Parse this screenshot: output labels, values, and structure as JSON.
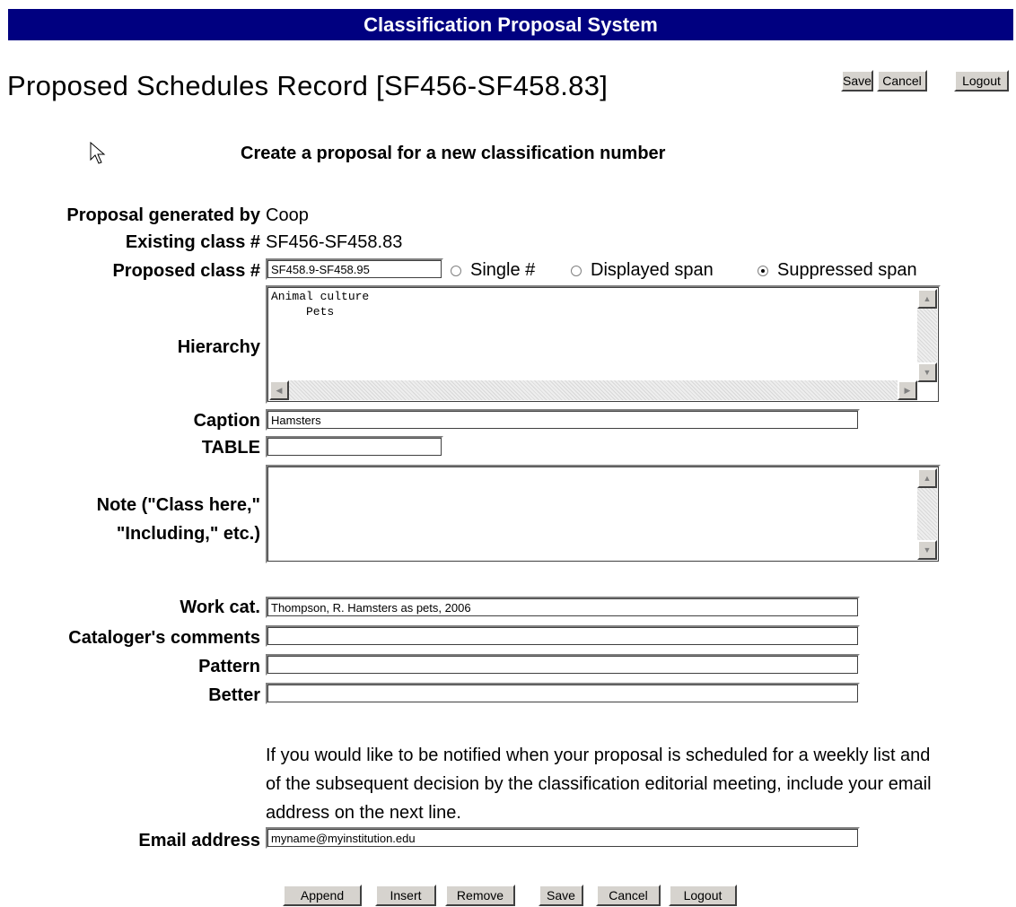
{
  "app_title": "Classification Proposal System",
  "page_title": "Proposed Schedules Record [SF456-SF458.83]",
  "top_buttons": {
    "save": "Save",
    "cancel": "Cancel",
    "logout": "Logout"
  },
  "subheading": "Create a proposal for a new classification number",
  "form": {
    "generated_by": {
      "label": "Proposal generated by",
      "value": "Coop"
    },
    "existing_class": {
      "label": "Existing class #",
      "value": "SF456-SF458.83"
    },
    "proposed_class": {
      "label": "Proposed class #",
      "value": "SF458.9-SF458.95",
      "options": [
        "Single #",
        "Displayed span",
        "Suppressed span"
      ],
      "selected": "Suppressed span"
    },
    "hierarchy": {
      "label": "Hierarchy",
      "value": "Animal culture\n     Pets"
    },
    "caption": {
      "label": "Caption",
      "value": "Hamsters"
    },
    "table": {
      "label": "TABLE",
      "value": ""
    },
    "note": {
      "label_line1": "Note (\"Class here,\"",
      "label_line2": "\"Including,\" etc.)",
      "value": ""
    },
    "work_cat": {
      "label": "Work cat.",
      "value": "Thompson, R. Hamsters as pets, 2006"
    },
    "cataloger_comments": {
      "label": "Cataloger's comments",
      "value": ""
    },
    "pattern": {
      "label": "Pattern",
      "value": ""
    },
    "better": {
      "label": "Better",
      "value": ""
    },
    "notify_text": "If you would like to be notified when your proposal is scheduled for a weekly list and of the subsequent decision by the classification editorial meeting, include your email address on the next line.",
    "email": {
      "label": "Email address",
      "value": "myname@myinstitution.edu"
    }
  },
  "bottom_buttons": {
    "append": "Append",
    "insert": "Insert",
    "remove": "Remove",
    "save": "Save",
    "cancel": "Cancel",
    "logout": "Logout"
  },
  "colors": {
    "banner": "#000080",
    "button_face": "#d6d3ce"
  }
}
